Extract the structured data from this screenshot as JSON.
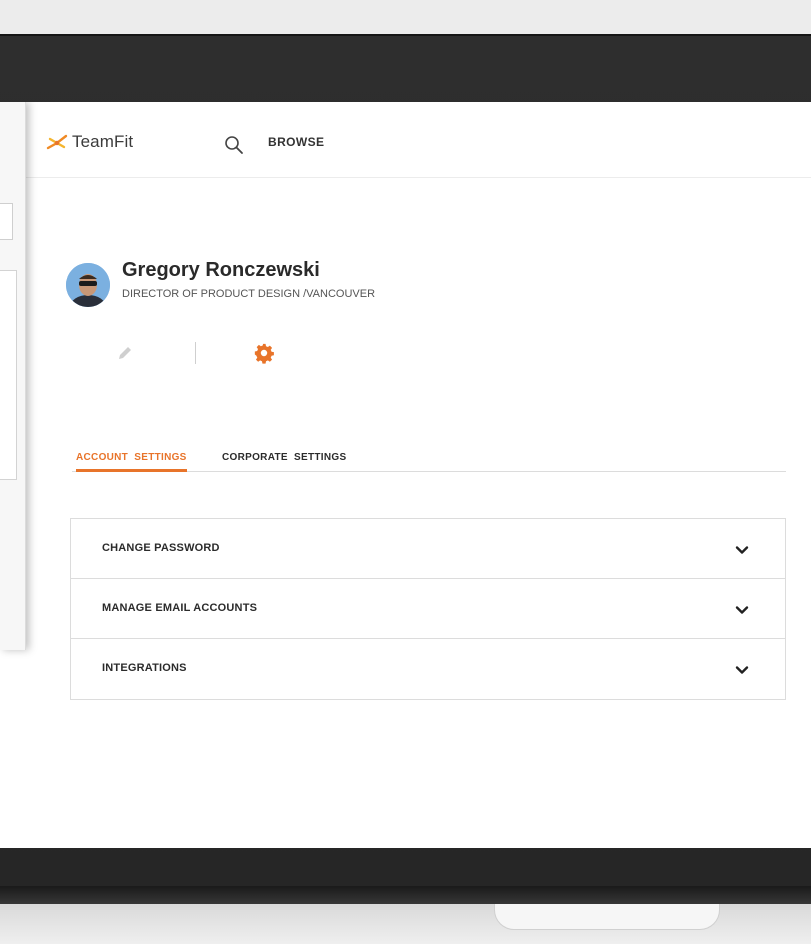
{
  "header": {
    "brand": "TeamFit",
    "nav_browse": "BROWSE"
  },
  "profile": {
    "name": "Gregory Ronczewski",
    "subtitle": "DIRECTOR OF PRODUCT DESIGN /VANCOUVER"
  },
  "tabs": [
    {
      "label": "ACCOUNT  SETTINGS",
      "active": true
    },
    {
      "label": "CORPORATE  SETTINGS",
      "active": false
    }
  ],
  "settings": [
    {
      "label": "CHANGE PASSWORD"
    },
    {
      "label": "MANAGE EMAIL ACCOUNTS"
    },
    {
      "label": "INTEGRATIONS"
    }
  ],
  "colors": {
    "accent": "#e8742a",
    "text": "#2b2b2b",
    "border": "#dcdcdc",
    "bezel": "#2a2a2a"
  },
  "icons": {
    "logo": "teamfit-logo-icon",
    "search": "search-icon",
    "edit": "pencil-icon",
    "settings": "gear-icon",
    "expand": "chevron-down-icon"
  }
}
